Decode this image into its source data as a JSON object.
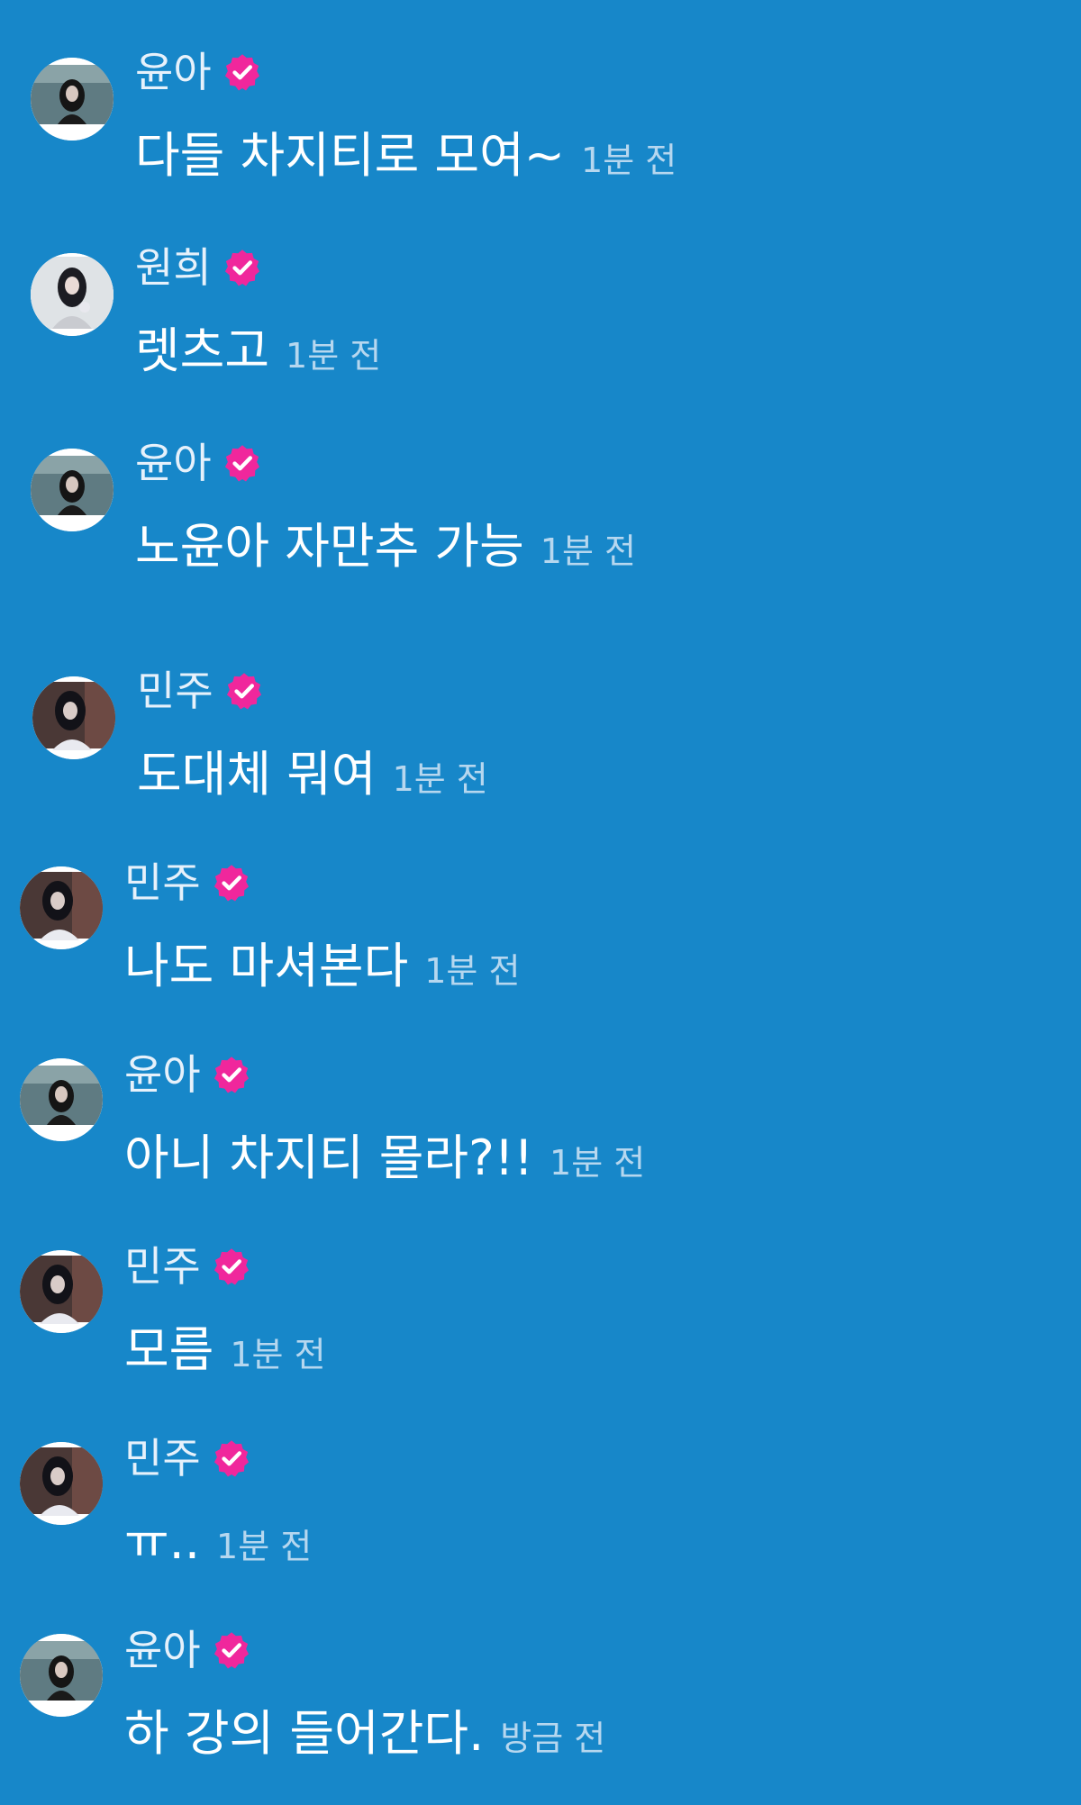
{
  "colors": {
    "background": "#1787c9",
    "verified_badge": "#f0279c",
    "name": "#e6f1fb",
    "message": "#ffffff",
    "timestamp": "#b6d7ef"
  },
  "messages": [
    {
      "name": "윤아",
      "verified": true,
      "text": "다들 차지티로 모여~",
      "time": "1분 전",
      "avatar": "yoona-avatar"
    },
    {
      "name": "원희",
      "verified": true,
      "text": "렛츠고",
      "time": "1분 전",
      "avatar": "wonhee-avatar"
    },
    {
      "name": "윤아",
      "verified": true,
      "text": "노윤아 자만추 가능",
      "time": "1분 전",
      "avatar": "yoona-avatar"
    },
    {
      "name": "민주",
      "verified": true,
      "text": "도대체 뭐여",
      "time": "1분 전",
      "avatar": "minju-avatar"
    },
    {
      "name": "민주",
      "verified": true,
      "text": "나도 마셔본다",
      "time": "1분 전",
      "avatar": "minju-avatar"
    },
    {
      "name": "윤아",
      "verified": true,
      "text": "아니 차지티 몰라?!!",
      "time": "1분 전",
      "avatar": "yoona-avatar"
    },
    {
      "name": "민주",
      "verified": true,
      "text": "모름",
      "time": "1분 전",
      "avatar": "minju-avatar"
    },
    {
      "name": "민주",
      "verified": true,
      "text": "ㅠ..",
      "time": "1분 전",
      "avatar": "minju-avatar"
    },
    {
      "name": "윤아",
      "verified": true,
      "text": "하 강의 들어간다.",
      "time": "방금 전",
      "avatar": "yoona-avatar"
    }
  ]
}
